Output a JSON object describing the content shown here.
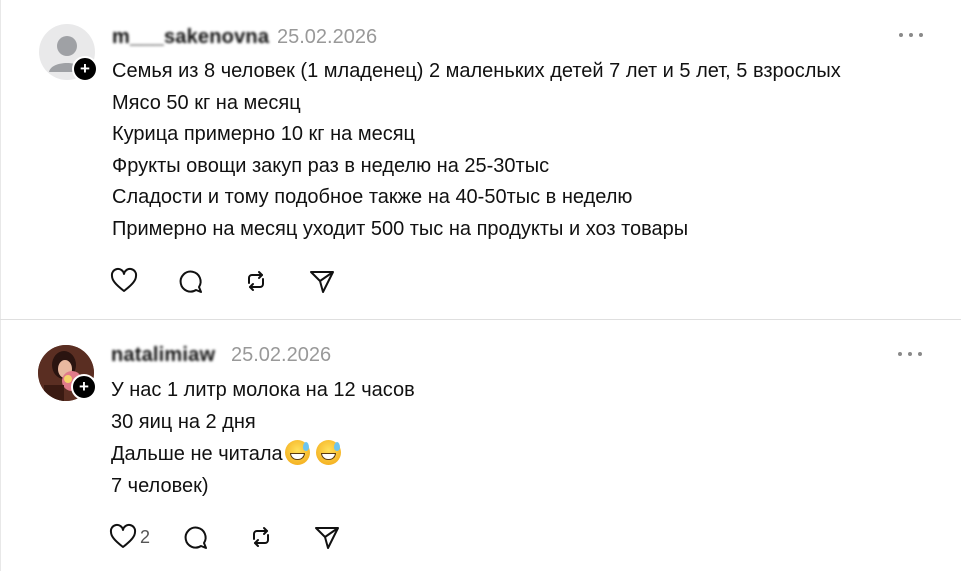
{
  "posts": [
    {
      "username": "m___sakenovna",
      "date": "25.02.2026",
      "lines": [
        "Семья из 8 человек (1 младенец) 2 маленьких детей 7 лет и 5 лет, 5 взрослых",
        "Мясо 50 кг на месяц",
        "Курица примерно 10 кг на месяц",
        "Фрукты овощи закуп раз в неделю на 25-30тыс",
        "Сладости и тому подобное также на 40-50тыс в неделю",
        "Примерно на месяц уходит 500 тыс на продукты и хоз товары"
      ],
      "likes": ""
    },
    {
      "username": "natalimiaw",
      "date": "25.02.2026",
      "lines": [
        "У нас 1 литр молока на 12 часов",
        "30 яиц на 2 дня",
        "Дальше не читала",
        "7 человек)"
      ],
      "likes": "2"
    }
  ],
  "icons": {
    "like": "heart-icon",
    "reply": "comment-icon",
    "repost": "repost-icon",
    "share": "send-icon",
    "more": "more-dots-icon",
    "follow": "plus-icon",
    "emoji": "grinning-sweat-emoji"
  },
  "colors": {
    "text": "#111111",
    "meta": "#999999",
    "divider": "#dfdfdf"
  }
}
